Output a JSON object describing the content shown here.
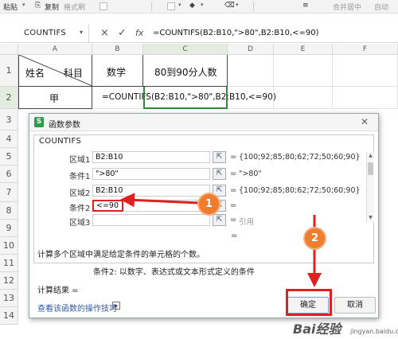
{
  "toolbar": {
    "paste": "粘贴",
    "copy": "复制",
    "format_painter": "格式刷",
    "merge_center": "合并居中",
    "auto_wrap": "自动"
  },
  "formula_bar": {
    "name_box": "COUNTIFS",
    "cancel_icon": "×",
    "confirm_icon": "✓",
    "fx": "fx",
    "formula": "=COUNTIFS(B2:B10,\">80\",B2:B10,<=90)"
  },
  "columns": [
    "A",
    "B",
    "C",
    "D",
    "E",
    "F"
  ],
  "rows": [
    "1",
    "2",
    "3",
    "4",
    "5",
    "6",
    "7",
    "8",
    "9",
    "10",
    "11",
    "12",
    "13",
    "14"
  ],
  "cells": {
    "a1_left": "姓名",
    "a1_right": "科目",
    "b1": "数学",
    "c1": "80到90分人数",
    "a2": "甲",
    "b2": "=COUNTIFS(B2:B10,\">80\",B2:B10,<=90)"
  },
  "dialog": {
    "title": "函数参数",
    "function_name": "COUNTIFS",
    "args": [
      {
        "label": "区域1",
        "input": "B2:B10",
        "result": "{100;92;85;80;62;72;50;60;90}"
      },
      {
        "label": "条件1",
        "input": "\">80\"",
        "result": "\">80\""
      },
      {
        "label": "区域2",
        "input": "B2:B10",
        "result": "{100;92;85;80;62;72;50;60;90}"
      },
      {
        "label": "条件2",
        "input": "<=90",
        "result": ""
      },
      {
        "label": "区域3",
        "input": "",
        "result": "引用"
      }
    ],
    "equals": "=",
    "description": "计算多个区域中满足给定条件的单元格的个数。",
    "condition_help": "条件2:  以数字、表达式或文本形式定义的条件",
    "result_label": "计算结果 =",
    "help_link": "查看该函数的操作技巧",
    "ok_button": "确定",
    "cancel_button": "取消"
  },
  "annotations": {
    "step1": "1",
    "step2": "2",
    "accent_color": "#e02020",
    "badge_color": "#f07c2e"
  },
  "watermark": {
    "main": "Bai经验",
    "sub": "jingyan.baidu.com"
  }
}
